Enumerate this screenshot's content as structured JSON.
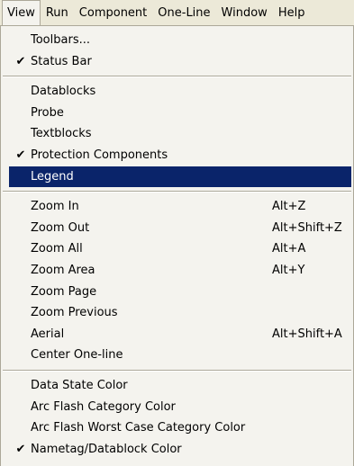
{
  "menubar": {
    "items": [
      {
        "label": "View"
      },
      {
        "label": "Run"
      },
      {
        "label": "Component"
      },
      {
        "label": "One-Line"
      },
      {
        "label": "Window"
      },
      {
        "label": "Help"
      }
    ]
  },
  "view_menu": {
    "groups": [
      {
        "items": [
          {
            "label": "Toolbars...",
            "checked": false,
            "shortcut": ""
          },
          {
            "label": "Status Bar",
            "checked": true,
            "shortcut": ""
          }
        ]
      },
      {
        "items": [
          {
            "label": "Datablocks",
            "checked": false,
            "shortcut": ""
          },
          {
            "label": "Probe",
            "checked": false,
            "shortcut": ""
          },
          {
            "label": "Textblocks",
            "checked": false,
            "shortcut": ""
          },
          {
            "label": "Protection Components",
            "checked": true,
            "shortcut": ""
          },
          {
            "label": "Legend",
            "checked": false,
            "shortcut": "",
            "highlighted": true
          }
        ]
      },
      {
        "items": [
          {
            "label": "Zoom In",
            "checked": false,
            "shortcut": "Alt+Z"
          },
          {
            "label": "Zoom Out",
            "checked": false,
            "shortcut": "Alt+Shift+Z"
          },
          {
            "label": "Zoom All",
            "checked": false,
            "shortcut": "Alt+A"
          },
          {
            "label": "Zoom Area",
            "checked": false,
            "shortcut": "Alt+Y"
          },
          {
            "label": "Zoom Page",
            "checked": false,
            "shortcut": ""
          },
          {
            "label": "Zoom Previous",
            "checked": false,
            "shortcut": ""
          },
          {
            "label": "Aerial",
            "checked": false,
            "shortcut": "Alt+Shift+A"
          },
          {
            "label": "Center One-line",
            "checked": false,
            "shortcut": ""
          }
        ]
      },
      {
        "items": [
          {
            "label": "Data State Color",
            "checked": false,
            "shortcut": ""
          },
          {
            "label": "Arc Flash Category Color",
            "checked": false,
            "shortcut": ""
          },
          {
            "label": "Arc Flash Worst Case Category Color",
            "checked": false,
            "shortcut": ""
          },
          {
            "label": "Nametag/Datablock Color",
            "checked": true,
            "shortcut": ""
          }
        ]
      }
    ],
    "check_glyph": "✔"
  },
  "colors": {
    "menubar_bg": "#ece9d8",
    "menu_bg": "#f4f3ee",
    "highlight_bg": "#0a246a",
    "highlight_text": "#ffffff",
    "border": "#aca899"
  }
}
